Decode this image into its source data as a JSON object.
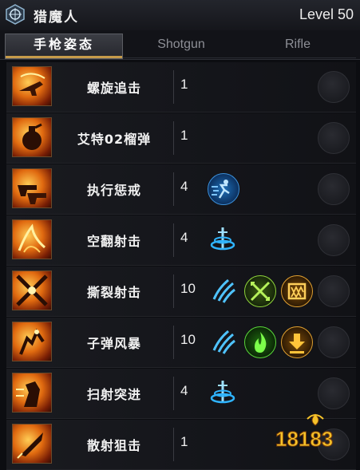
{
  "header": {
    "class_name": "猎魔人",
    "level": "Level 50"
  },
  "tabs": [
    {
      "label": "手枪姿态",
      "active": true
    },
    {
      "label": "Shotgun",
      "active": false
    },
    {
      "label": "Rifle",
      "active": false
    }
  ],
  "skills": [
    {
      "name": "螺旋追击",
      "level": "1",
      "icon": "spinning-pistol-icon",
      "tripods": []
    },
    {
      "name": "艾特02榴弹",
      "level": "1",
      "icon": "grenade-icon",
      "tripods": []
    },
    {
      "name": "执行惩戒",
      "level": "4",
      "icon": "dual-pistol-icon",
      "tripods": [
        "dash-speed-icon"
      ]
    },
    {
      "name": "空翻射击",
      "level": "4",
      "icon": "flip-shot-icon",
      "tripods": [
        "whirl-sword-icon"
      ]
    },
    {
      "name": "撕裂射击",
      "level": "10",
      "icon": "cross-shot-icon",
      "tripods": [
        "claw-slash-icon",
        "crossed-arrows-icon",
        "beast-maw-icon"
      ]
    },
    {
      "name": "子弹风暴",
      "level": "10",
      "icon": "bullet-storm-icon",
      "tripods": [
        "claw-slash-icon",
        "flame-icon",
        "down-arrow-icon"
      ]
    },
    {
      "name": "扫射突进",
      "level": "4",
      "icon": "rush-fire-icon",
      "tripods": [
        "whirl-sword-icon"
      ]
    },
    {
      "name": "散射狙击",
      "level": "1",
      "icon": "snipe-bullet-icon",
      "tripods": []
    }
  ],
  "watermark": {
    "text": "18183"
  }
}
